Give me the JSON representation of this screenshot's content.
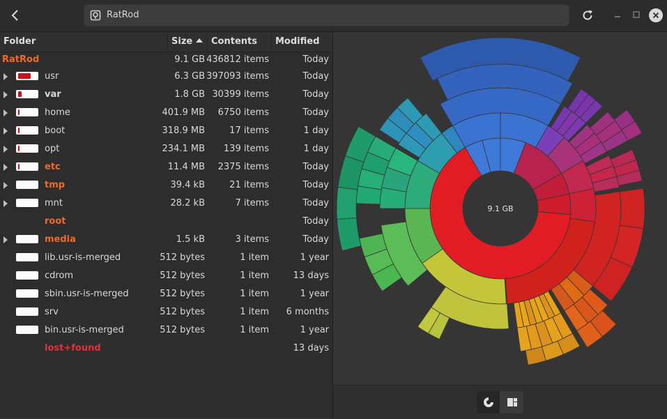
{
  "window": {
    "path": "RatRod"
  },
  "columns": {
    "folder": "Folder",
    "size": "Size",
    "contents": "Contents",
    "modified": "Modified"
  },
  "root": {
    "name": "RatRod",
    "size": "9.1 GB",
    "contents": "436812 items",
    "modified": "Today"
  },
  "rows": [
    {
      "name": "usr",
      "size": "6.3 GB",
      "contents": "397093 items",
      "modified": "Today",
      "expandable": true,
      "style": "normal",
      "fraction": 0.69
    },
    {
      "name": "var",
      "size": "1.8 GB",
      "contents": "30399 items",
      "modified": "Today",
      "expandable": true,
      "style": "bold",
      "fraction": 0.2
    },
    {
      "name": "home",
      "size": "401.9 MB",
      "contents": "6750 items",
      "modified": "Today",
      "expandable": true,
      "style": "normal",
      "fraction": 0.044
    },
    {
      "name": "boot",
      "size": "318.9 MB",
      "contents": "17 items",
      "modified": "1 day",
      "expandable": true,
      "style": "normal",
      "fraction": 0.035
    },
    {
      "name": "opt",
      "size": "234.1 MB",
      "contents": "139 items",
      "modified": "1 day",
      "expandable": true,
      "style": "normal",
      "fraction": 0.026
    },
    {
      "name": "etc",
      "size": "11.4 MB",
      "contents": "2375 items",
      "modified": "Today",
      "expandable": true,
      "style": "orange",
      "fraction": 0.001
    },
    {
      "name": "tmp",
      "size": "39.4 kB",
      "contents": "21 items",
      "modified": "Today",
      "expandable": true,
      "style": "orange",
      "fraction": 0
    },
    {
      "name": "mnt",
      "size": "28.2 kB",
      "contents": "7 items",
      "modified": "Today",
      "expandable": true,
      "style": "normal",
      "fraction": 0
    },
    {
      "name": "root",
      "size": "",
      "contents": "",
      "modified": "Today",
      "expandable": false,
      "style": "orange",
      "fraction": null
    },
    {
      "name": "media",
      "size": "1.5 kB",
      "contents": "3 items",
      "modified": "Today",
      "expandable": true,
      "style": "orange",
      "fraction": 0
    },
    {
      "name": "lib.usr-is-merged",
      "size": "512 bytes",
      "contents": "1 item",
      "modified": "1 year",
      "expandable": false,
      "style": "normal",
      "fraction": 0
    },
    {
      "name": "cdrom",
      "size": "512 bytes",
      "contents": "1 item",
      "modified": "13 days",
      "expandable": false,
      "style": "normal",
      "fraction": 0
    },
    {
      "name": "sbin.usr-is-merged",
      "size": "512 bytes",
      "contents": "1 item",
      "modified": "1 year",
      "expandable": false,
      "style": "normal",
      "fraction": 0
    },
    {
      "name": "srv",
      "size": "512 bytes",
      "contents": "1 item",
      "modified": "6 months",
      "expandable": false,
      "style": "normal",
      "fraction": 0
    },
    {
      "name": "bin.usr-is-merged",
      "size": "512 bytes",
      "contents": "1 item",
      "modified": "1 year",
      "expandable": false,
      "style": "normal",
      "fraction": 0
    },
    {
      "name": "lost+found",
      "size": "",
      "contents": "",
      "modified": "13 days",
      "expandable": false,
      "style": "red",
      "fraction": null
    }
  ],
  "ring_chart": {
    "center_label": "9.1 GB"
  },
  "icons": {
    "back": "back-arrow-icon",
    "path": "drive-icon",
    "reload": "reload-icon",
    "ring_view": "ring-chart-icon",
    "treemap_view": "treemap-icon"
  },
  "colors": {
    "accent_orange": "#ec6b2c",
    "accent_red": "#e0333b",
    "usage_bar": "#c8141e"
  }
}
